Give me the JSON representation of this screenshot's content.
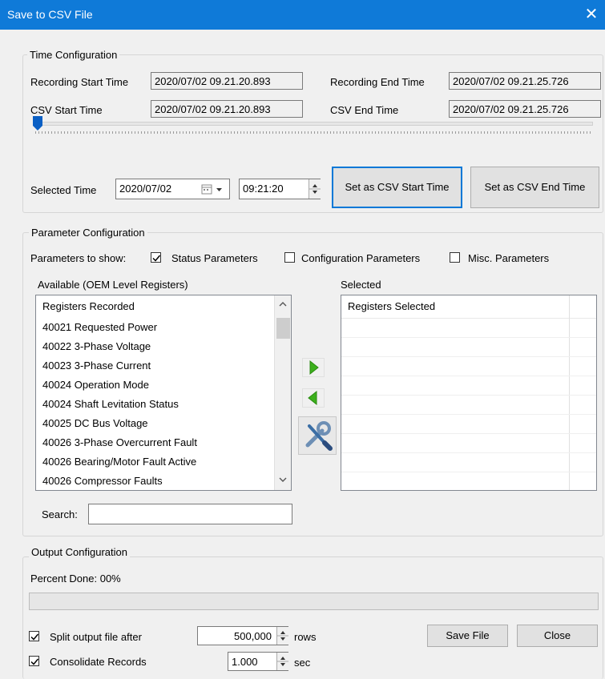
{
  "window": {
    "title": "Save to CSV File",
    "close": "✕"
  },
  "time_config": {
    "legend": "Time Configuration",
    "rec_start_label": "Recording Start Time",
    "rec_start": "2020/07/02 09.21.20.893",
    "rec_end_label": "Recording End Time",
    "rec_end": "2020/07/02 09.21.25.726",
    "csv_start_label": "CSV Start Time",
    "csv_start": "2020/07/02 09.21.20.893",
    "csv_end_label": "CSV End Time",
    "csv_end": "2020/07/02 09.21.25.726",
    "slider_value": 0.0,
    "selected_label": "Selected Time",
    "date": "2020/07/02",
    "time": "09:21:20",
    "set_start_btn": "Set as CSV Start Time",
    "set_end_btn": "Set as CSV End Time"
  },
  "param_config": {
    "legend": "Parameter Configuration",
    "show_label": "Parameters to show:",
    "checks": [
      {
        "label": "Status Parameters",
        "checked": true
      },
      {
        "label": "Configuration Parameters",
        "checked": false
      },
      {
        "label": "Misc. Parameters",
        "checked": false
      }
    ],
    "available_label": "Available (OEM Level Registers)",
    "available_header": "Registers Recorded",
    "registers": [
      "40021 Requested Power",
      "40022 3-Phase Voltage",
      "40023 3-Phase Current",
      "40024 Operation Mode",
      "40024 Shaft Levitation Status",
      "40025 DC Bus Voltage",
      "40026 3-Phase Overcurrent Fault",
      "40026 Bearing/Motor Fault Active",
      "40026 Compressor Faults"
    ],
    "selected_label": "Selected",
    "selected_header": "Registers Selected",
    "search_label": "Search:",
    "search_value": ""
  },
  "output_config": {
    "legend": "Output Configuration",
    "percent_label": "Percent Done: 00%",
    "progress": 0,
    "split_label": "Split output file after",
    "split_checked": true,
    "split_value": "500,000",
    "split_unit": "rows",
    "consolidate_label": "Consolidate Records",
    "consolidate_checked": true,
    "consolidate_value": "1.000",
    "consolidate_unit": "sec",
    "save_btn": "Save File",
    "close_btn": "Close"
  },
  "colors": {
    "titlebar": "#0f7ad8",
    "focus": "#0078d7",
    "slider_thumb": "#0a5fc4",
    "arrow_green": "#3cb01c"
  }
}
